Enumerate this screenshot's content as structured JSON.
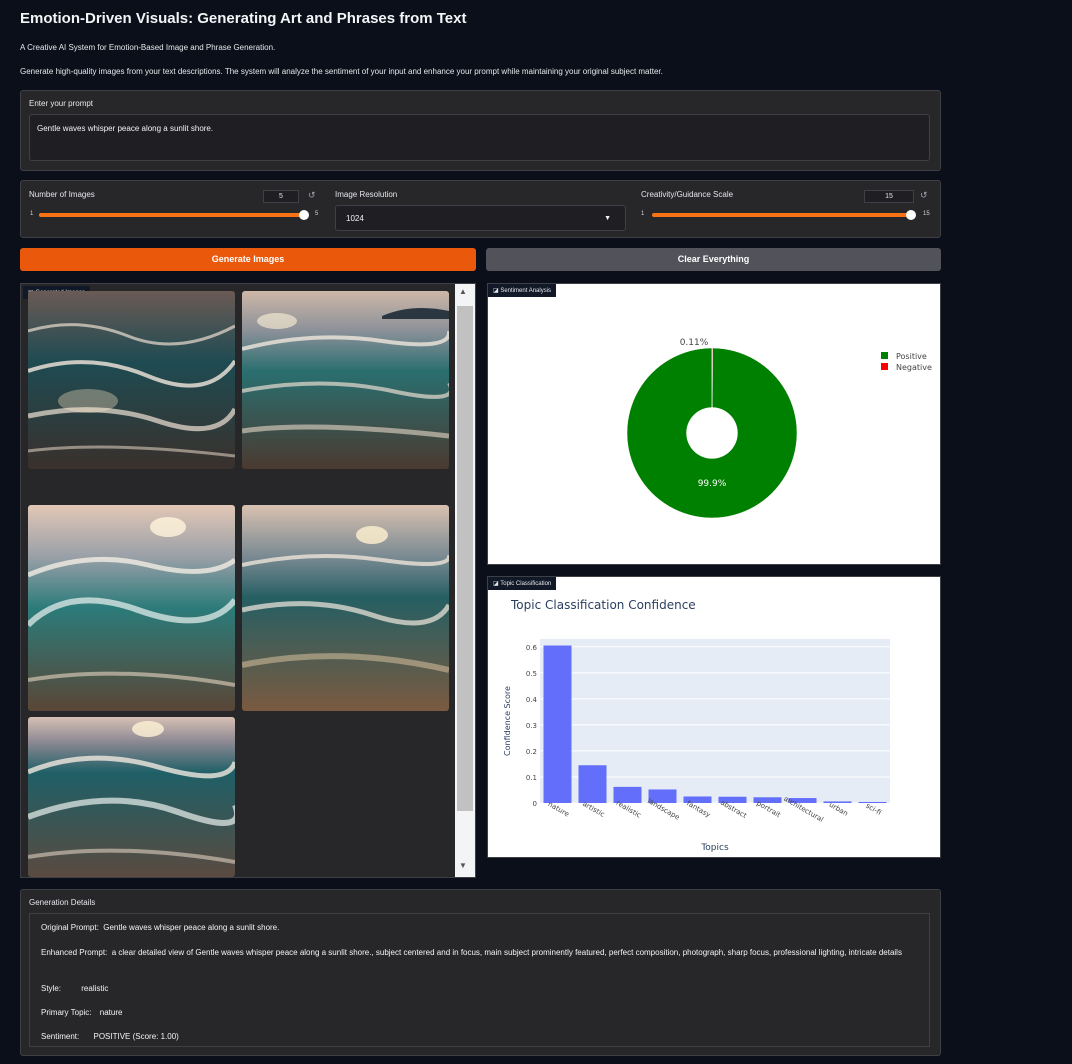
{
  "header": {
    "title": "Emotion-Driven Visuals: Generating Art and Phrases from Text",
    "subtitle": "A Creative AI System for Emotion-Based Image and Phrase Generation.",
    "description": "Generate high-quality images from your text descriptions. The system will analyze the sentiment of your input and enhance your prompt while maintaining your original subject matter."
  },
  "prompt": {
    "label": "Enter your prompt",
    "value": "Gentle waves whisper peace along a sunlit shore."
  },
  "controls": {
    "num_images": {
      "label": "Number of Images",
      "value": "5",
      "min": "1",
      "max": "5",
      "fraction": 1.0
    },
    "resolution": {
      "label": "Image Resolution",
      "value": "1024"
    },
    "guidance": {
      "label": "Creativity/Guidance Scale",
      "value": "15",
      "min": "1",
      "max": "15",
      "fraction": 1.0
    },
    "reset_icon": "reset-icon"
  },
  "buttons": {
    "generate": "Generate Images",
    "clear": "Clear Everything",
    "generate_color": "#ea580c",
    "clear_color": "#52525b"
  },
  "gallery": {
    "label": "Generated Images",
    "count": 5
  },
  "sentiment": {
    "label": "Sentiment Analysis",
    "chart_data": {
      "type": "pie",
      "labels": [
        "Positive",
        "Negative"
      ],
      "values": [
        99.89,
        0.11
      ],
      "value_labels": [
        "99.9%",
        "0.11%"
      ],
      "colors": [
        "#008000",
        "#ff0000"
      ],
      "hole": 0.3,
      "legend": "top-right"
    }
  },
  "topics": {
    "label": "Topic Classification",
    "chart_data": {
      "type": "bar",
      "title": "Topic Classification Confidence",
      "xlabel": "Topics",
      "ylabel": "Confidence Score",
      "categories": [
        "nature",
        "artistic",
        "realistic",
        "landscape",
        "fantasy",
        "abstract",
        "portrait",
        "architectural",
        "urban",
        "sci-fi"
      ],
      "values": [
        0.605,
        0.145,
        0.062,
        0.052,
        0.025,
        0.024,
        0.022,
        0.019,
        0.006,
        0.004
      ],
      "ylim": [
        0,
        0.63
      ],
      "yticks": [
        "0",
        "0.1",
        "0.2",
        "0.3",
        "0.4",
        "0.5",
        "0.6"
      ],
      "bar_color": "#636efa",
      "plot_bg": "#e5ecf6"
    }
  },
  "details": {
    "label": "Generation Details",
    "original_label": "Original Prompt:",
    "original_value": "Gentle waves whisper peace along a sunlit shore.",
    "enhanced_label": "Enhanced Prompt:",
    "enhanced_value": "a clear detailed view of Gentle waves whisper peace along a sunlit shore., subject centered and in focus, main subject prominently featured, perfect composition, photograph, sharp focus, professional lighting, intricate details",
    "style_label": "Style:",
    "style_value": "realistic",
    "topic_label": "Primary Topic:",
    "topic_value": "nature",
    "sentiment_label": "Sentiment:",
    "sentiment_value": "POSITIVE (Score: 1.00)"
  }
}
